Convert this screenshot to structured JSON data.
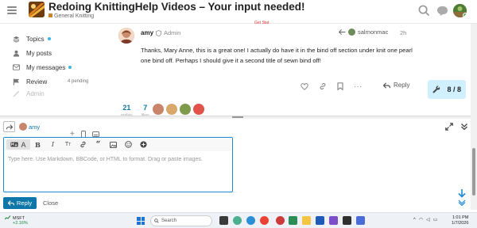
{
  "header": {
    "title": "Redoing KnittingHelp Videos – Your input needed!",
    "category": "General Knitting",
    "red_snippet": "Get Stat"
  },
  "sidebar": {
    "items": [
      {
        "label": "Topics",
        "icon": "layers-icon",
        "dot": true
      },
      {
        "label": "My posts",
        "icon": "user-icon",
        "dot": false
      },
      {
        "label": "My messages",
        "icon": "envelope-icon",
        "dot": true
      },
      {
        "label": "Review",
        "icon": "flag-icon",
        "dot": false,
        "badge": "4 pending"
      },
      {
        "label": "Admin",
        "icon": "wrench-icon",
        "dot": false
      }
    ]
  },
  "post": {
    "username": "amy",
    "role": "Admin",
    "reply_to_user": "salmonmac",
    "time": "2h",
    "body": "Thanks, Mary Anne, this is a great one! I actually do have it in the bind off section under knit one pearl one bind off. Perhaps I should give it a second title of sewn bind off!",
    "reply_label": "Reply"
  },
  "progress": {
    "label": "8 / 8"
  },
  "stats": {
    "replies": {
      "value": "21",
      "label": "replies"
    },
    "views": {
      "value": "7",
      "label": "likes"
    }
  },
  "composer": {
    "user": "amy",
    "placeholder": "Type here. Use Markdown, BBCode, or HTML to format. Drag or paste images.",
    "reply_button": "Reply",
    "close_button": "Close"
  },
  "taskbar": {
    "stock_name": "MSFT",
    "stock_change": "+2.16%",
    "search_placeholder": "Search",
    "time": "1:01 PM",
    "date": "1/7/2026"
  },
  "colors": {
    "accent": "#0e76a8",
    "progress_bg": "#d1f0ff",
    "editor_border": "#1d8ad3"
  }
}
